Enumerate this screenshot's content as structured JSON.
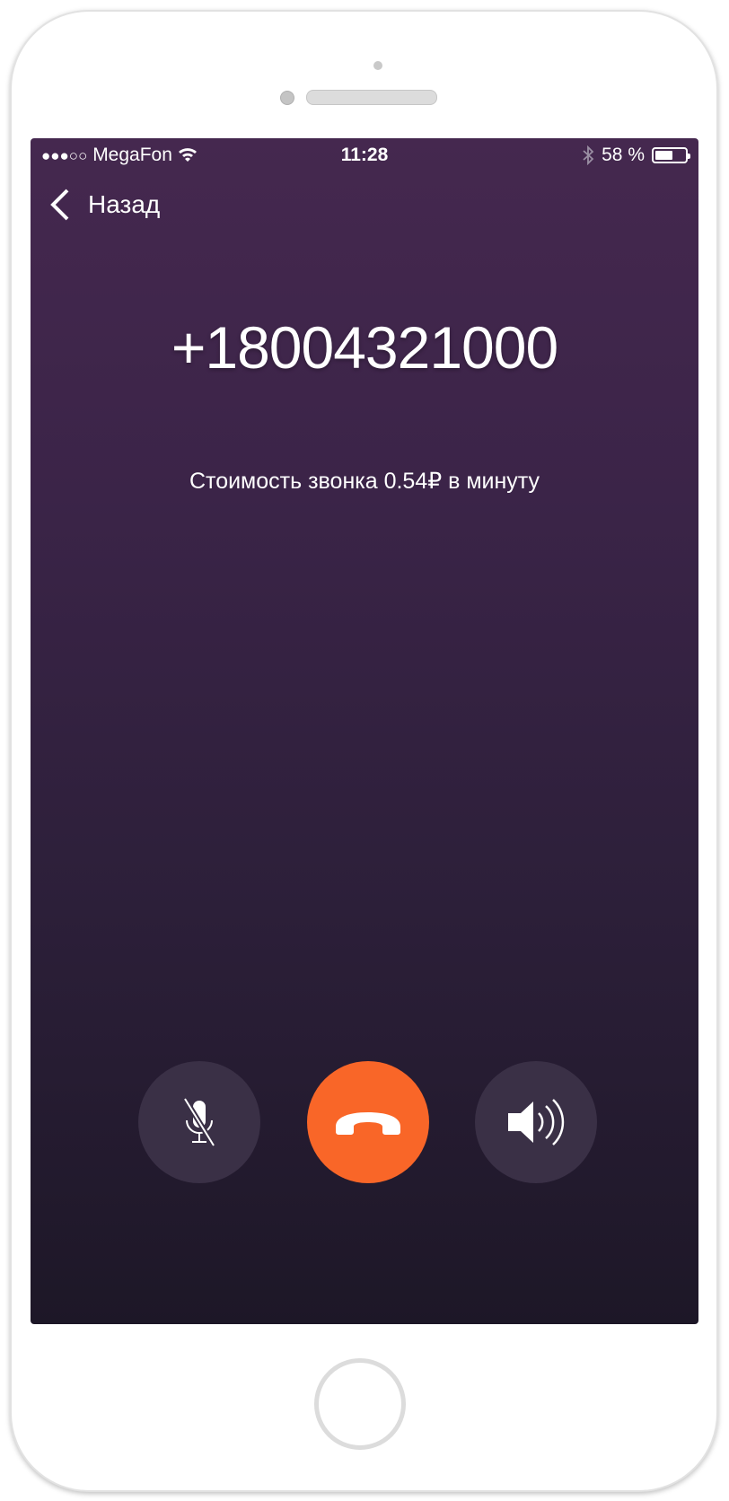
{
  "status_bar": {
    "signal": "●●●○○",
    "carrier": "MegaFon",
    "time": "11:28",
    "battery_text": "58 %",
    "battery_level": 0.58
  },
  "nav": {
    "back_label": "Назад"
  },
  "call": {
    "number": "+18004321000",
    "cost_text": "Стоимость звонка 0.54₽ в минуту"
  },
  "controls": [
    {
      "icon": "microphone-muted-icon"
    },
    {
      "icon": "end-call-icon",
      "color": "#f96628"
    },
    {
      "icon": "speaker-icon"
    }
  ],
  "colors": {
    "bg_top": "#45284f",
    "bg_bottom": "#1d1727",
    "end_call": "#f96628",
    "button_bg": "#3a3046"
  }
}
